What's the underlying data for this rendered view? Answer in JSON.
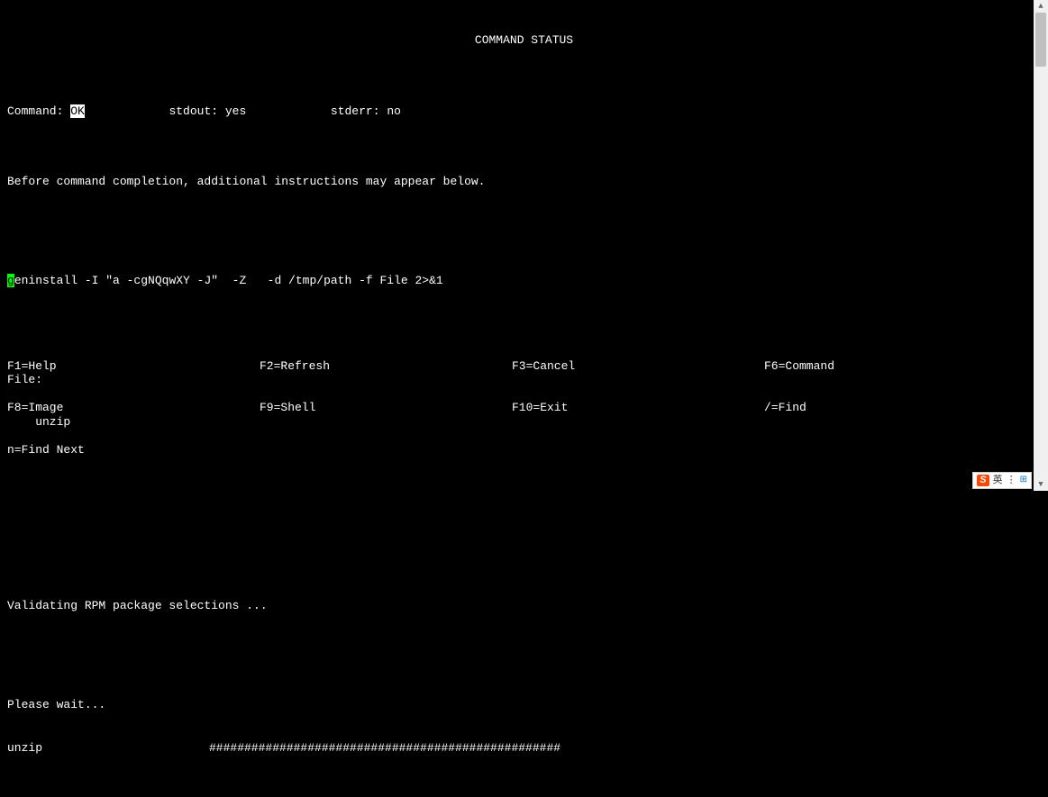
{
  "title": "COMMAND STATUS",
  "status_line": {
    "command_label": "Command: ",
    "command_value": "OK",
    "stdout_label": "stdout: ",
    "stdout_value": "yes",
    "stderr_label": "stderr: ",
    "stderr_value": "no"
  },
  "before_msg": "Before command completion, additional instructions may appear below.",
  "cmd_first_char": "g",
  "cmd_rest": "eninstall -I \"a -cgNQqwXY -J\"  -Z   -d /tmp/path -f File 2>&1",
  "file_label": "File:",
  "file_value": "    unzip",
  "validating_msg": "Validating RPM package selections ...",
  "wait_msg": "Please wait...",
  "progress_label": "unzip",
  "progress_bar": "##################################################",
  "footer": {
    "row1": {
      "c1": "F1=Help",
      "c2": "F2=Refresh",
      "c3": "F3=Cancel",
      "c4": "F6=Command"
    },
    "row2": {
      "c1": "F8=Image",
      "c2": "F9=Shell",
      "c3": "F10=Exit",
      "c4": "/=Find"
    },
    "row3": {
      "c1": "n=Find Next",
      "c2": "",
      "c3": "",
      "c4": ""
    }
  },
  "ime": {
    "logo": "S",
    "text": "英",
    "grid": "⊞"
  }
}
